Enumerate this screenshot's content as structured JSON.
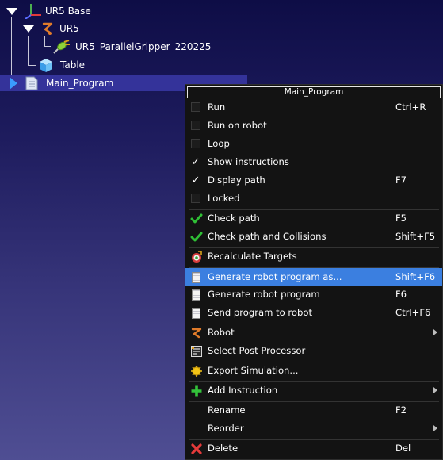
{
  "tree": {
    "base_label": "UR5 Base",
    "robot_label": "UR5",
    "gripper_label": "UR5_ParallelGripper_220225",
    "table_label": "Table",
    "program_label": "Main_Program"
  },
  "context_menu": {
    "title": "Main_Program",
    "items": [
      {
        "label": "Run",
        "shortcut": "Ctrl+R",
        "icon": "checkbox-unchecked"
      },
      {
        "label": "Run on robot",
        "shortcut": "",
        "icon": "checkbox-unchecked"
      },
      {
        "label": "Loop",
        "shortcut": "",
        "icon": "checkbox-unchecked"
      },
      {
        "label": "Show instructions",
        "shortcut": "",
        "icon": "checkmark"
      },
      {
        "label": "Display path",
        "shortcut": "F7",
        "icon": "checkmark"
      },
      {
        "label": "Locked",
        "shortcut": "",
        "icon": "checkbox-unchecked"
      },
      {
        "label": "Check path",
        "shortcut": "F5",
        "icon": "green-check-icon"
      },
      {
        "label": "Check path and Collisions",
        "shortcut": "Shift+F5",
        "icon": "green-check-icon"
      },
      {
        "label": "Recalculate Targets",
        "shortcut": "",
        "icon": "target-icon"
      },
      {
        "label": "Generate robot program as...",
        "shortcut": "Shift+F6",
        "icon": "document-icon"
      },
      {
        "label": "Generate robot program",
        "shortcut": "F6",
        "icon": "document-icon"
      },
      {
        "label": "Send program to robot",
        "shortcut": "Ctrl+F6",
        "icon": "document-icon"
      },
      {
        "label": "Robot",
        "shortcut": "",
        "icon": "robot-arm-icon"
      },
      {
        "label": "Select Post Processor",
        "shortcut": "",
        "icon": "post-processor-icon"
      },
      {
        "label": "Export Simulation...",
        "shortcut": "",
        "icon": "export-simulation-icon"
      },
      {
        "label": "Add Instruction",
        "shortcut": "",
        "icon": "green-plus-icon"
      },
      {
        "label": "Rename",
        "shortcut": "F2",
        "icon": ""
      },
      {
        "label": "Reorder",
        "shortcut": "",
        "icon": ""
      },
      {
        "label": "Delete",
        "shortcut": "Del",
        "icon": "red-x-icon"
      }
    ]
  },
  "colors": {
    "highlight": "#3b7fe0",
    "menu_background": "#131313",
    "tree_selection": "#34339a",
    "check_green": "#2fbf35",
    "delete_red": "#e53a3a"
  }
}
